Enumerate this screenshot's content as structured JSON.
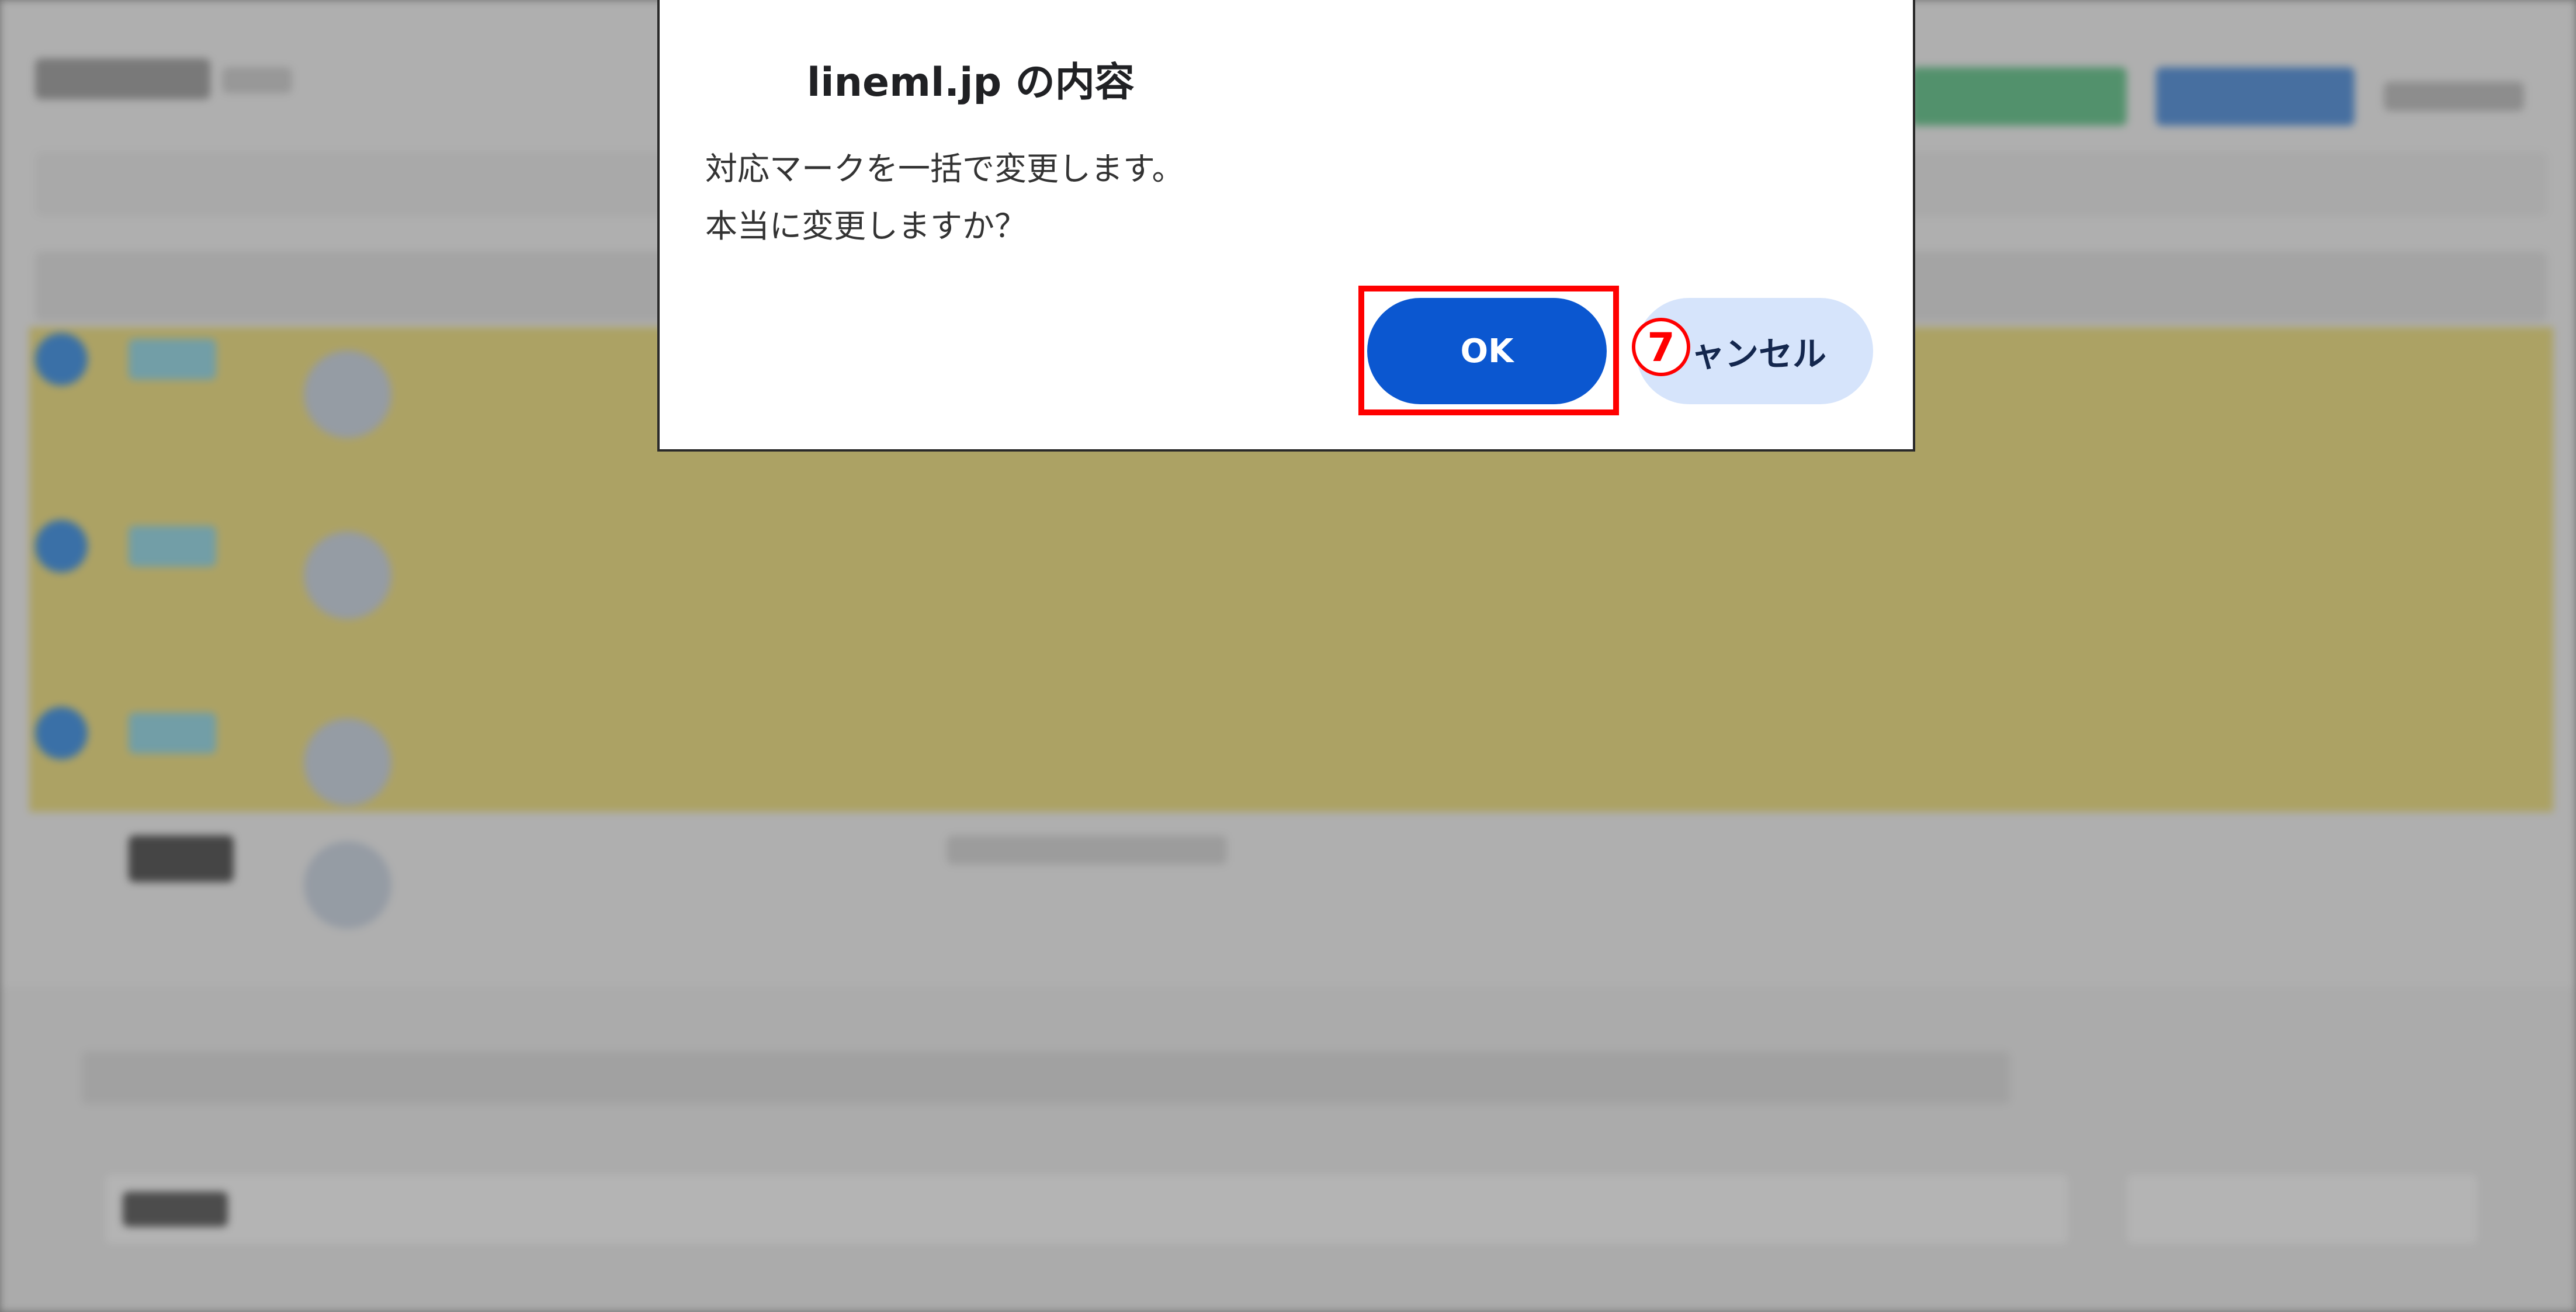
{
  "dialog": {
    "title": "lineml.jp の内容",
    "message_line1": "対応マークを一括で変更します。",
    "message_line2": "本当に変更しますか？",
    "ok_label": "OK",
    "cancel_label": "ャンセル"
  },
  "annotation": {
    "step_number": "7"
  },
  "colors": {
    "ok_button": "#0b57d0",
    "cancel_button": "#d6e4fb",
    "highlight": "#ff0000",
    "selected_rows": "#e9d97a"
  }
}
